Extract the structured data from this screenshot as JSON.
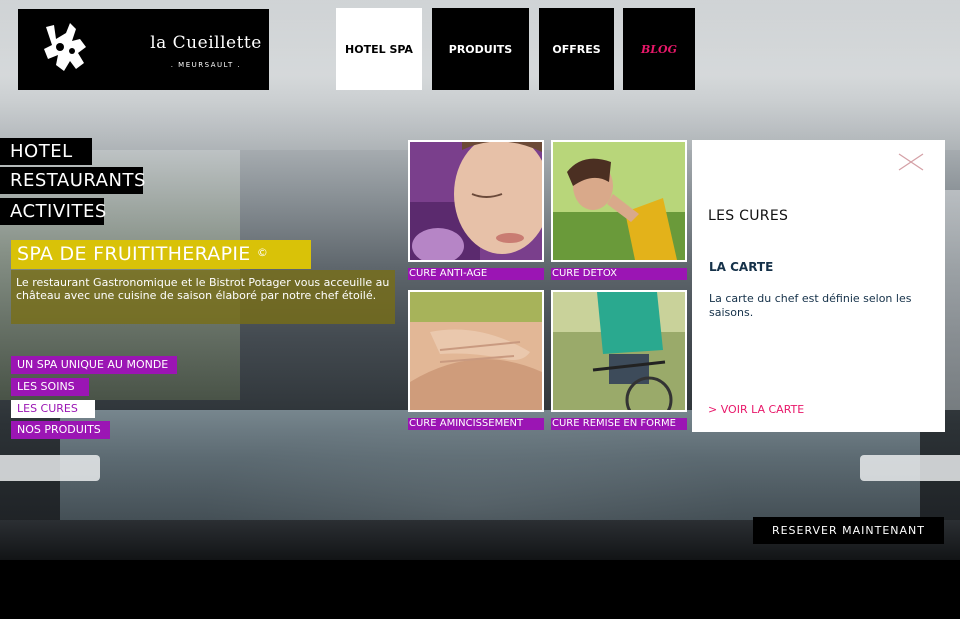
{
  "brand": {
    "name": "la Cueillette",
    "place": ". MEURSAULT ."
  },
  "topnav": [
    {
      "label": "HOTEL SPA",
      "active": true
    },
    {
      "label": "PRODUITS",
      "active": false
    },
    {
      "label": "OFFRES",
      "active": false
    },
    {
      "label": "BLOG",
      "active": false
    }
  ],
  "leftnav": [
    "HOTEL",
    "RESTAURANTS",
    "ACTIVITES"
  ],
  "spa": {
    "title": "SPA DE FRUITITHERAPIE",
    "title_mark": "©",
    "description": "Le restaurant Gastronomique et le Bistrot Potager vous acceuille au château avec une cuisine de saison élaboré par notre chef étoilé."
  },
  "subnav": [
    {
      "label": "UN SPA UNIQUE AU MONDE",
      "active": false
    },
    {
      "label": "LES SOINS",
      "active": false
    },
    {
      "label": "LES CURES",
      "active": true
    },
    {
      "label": "NOS PRODUITS",
      "active": false
    }
  ],
  "cures": [
    {
      "label": "CURE ANTI-AGE",
      "image": "face-closed-eyes"
    },
    {
      "label": "CURE DETOX",
      "image": "woman-sunlight"
    },
    {
      "label": "CURE AMINCISSEMENT",
      "image": "massage-back"
    },
    {
      "label": "CURE REMISE EN FORME",
      "image": "bicycle-rider"
    }
  ],
  "panel": {
    "title": "LES CURES",
    "subtitle": "LA CARTE",
    "description": "La carte du chef est définie selon les saisons.",
    "link": "> VOIR LA CARTE"
  },
  "reserve": "RESERVER MAINTENANT",
  "colors": {
    "accent_purple": "#9b15b4",
    "accent_yellow": "#d9c208",
    "accent_pink": "#e8186a"
  }
}
